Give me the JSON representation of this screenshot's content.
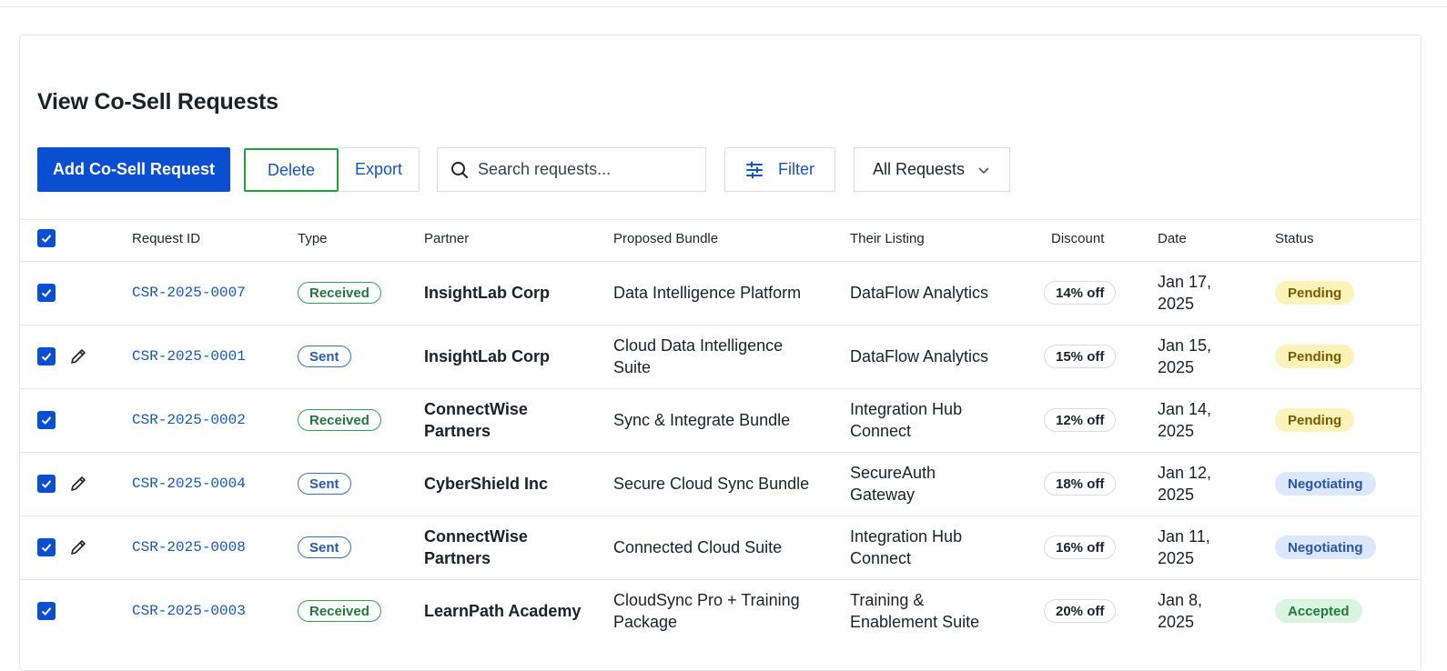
{
  "page": {
    "title": "View Co-Sell Requests"
  },
  "toolbar": {
    "add_label": "Add Co-Sell Request",
    "delete_label": "Delete",
    "export_label": "Export",
    "search_placeholder": "Search requests...",
    "filter_label": "Filter",
    "select_value": "All Requests"
  },
  "table": {
    "headers": [
      "Request ID",
      "Type",
      "Partner",
      "Proposed Bundle",
      "Their Listing",
      "Discount",
      "Date",
      "Status"
    ],
    "rows": [
      {
        "id": "CSR-2025-0007",
        "type": "Received",
        "partner": [
          "InsightLab Corp"
        ],
        "bundle": [
          "Data Intelligence Platform"
        ],
        "listing": [
          "DataFlow Analytics"
        ],
        "discount": "14% off",
        "date": [
          "Jan 17,",
          "2025"
        ],
        "status": "Pending",
        "editable": false,
        "checked": true
      },
      {
        "id": "CSR-2025-0001",
        "type": "Sent",
        "partner": [
          "InsightLab Corp"
        ],
        "bundle": [
          "Cloud Data Intelligence",
          "Suite"
        ],
        "listing": [
          "DataFlow Analytics"
        ],
        "discount": "15% off",
        "date": [
          "Jan 15,",
          "2025"
        ],
        "status": "Pending",
        "editable": true,
        "checked": true
      },
      {
        "id": "CSR-2025-0002",
        "type": "Received",
        "partner": [
          "ConnectWise",
          "Partners"
        ],
        "bundle": [
          "Sync & Integrate Bundle"
        ],
        "listing": [
          "Integration Hub",
          "Connect"
        ],
        "discount": "12% off",
        "date": [
          "Jan 14,",
          "2025"
        ],
        "status": "Pending",
        "editable": false,
        "checked": true
      },
      {
        "id": "CSR-2025-0004",
        "type": "Sent",
        "partner": [
          "CyberShield Inc"
        ],
        "bundle": [
          "Secure Cloud Sync Bundle"
        ],
        "listing": [
          "SecureAuth",
          "Gateway"
        ],
        "discount": "18% off",
        "date": [
          "Jan 12,",
          "2025"
        ],
        "status": "Negotiating",
        "editable": true,
        "checked": true
      },
      {
        "id": "CSR-2025-0008",
        "type": "Sent",
        "partner": [
          "ConnectWise",
          "Partners"
        ],
        "bundle": [
          "Connected Cloud Suite"
        ],
        "listing": [
          "Integration Hub",
          "Connect"
        ],
        "discount": "16% off",
        "date": [
          "Jan 11,",
          "2025"
        ],
        "status": "Negotiating",
        "editable": true,
        "checked": true
      },
      {
        "id": "CSR-2025-0003",
        "type": "Received",
        "partner": [
          "LearnPath Academy"
        ],
        "bundle": [
          "CloudSync Pro + Training",
          "Package"
        ],
        "listing": [
          "Training &",
          "Enablement Suite"
        ],
        "discount": "20% off",
        "date": [
          "Jan 8,",
          "2025"
        ],
        "status": "Accepted",
        "editable": false,
        "checked": true
      }
    ]
  },
  "icons": {
    "search": "search-icon",
    "filter": "sliders-icon",
    "select": "chevron-down-icon",
    "edit": "pencil-icon",
    "checkbox": "checkmark-icon"
  },
  "colors": {
    "primary": "#0a4fd1",
    "link": "#1456c0",
    "delete_outline": "#1fa13d"
  }
}
